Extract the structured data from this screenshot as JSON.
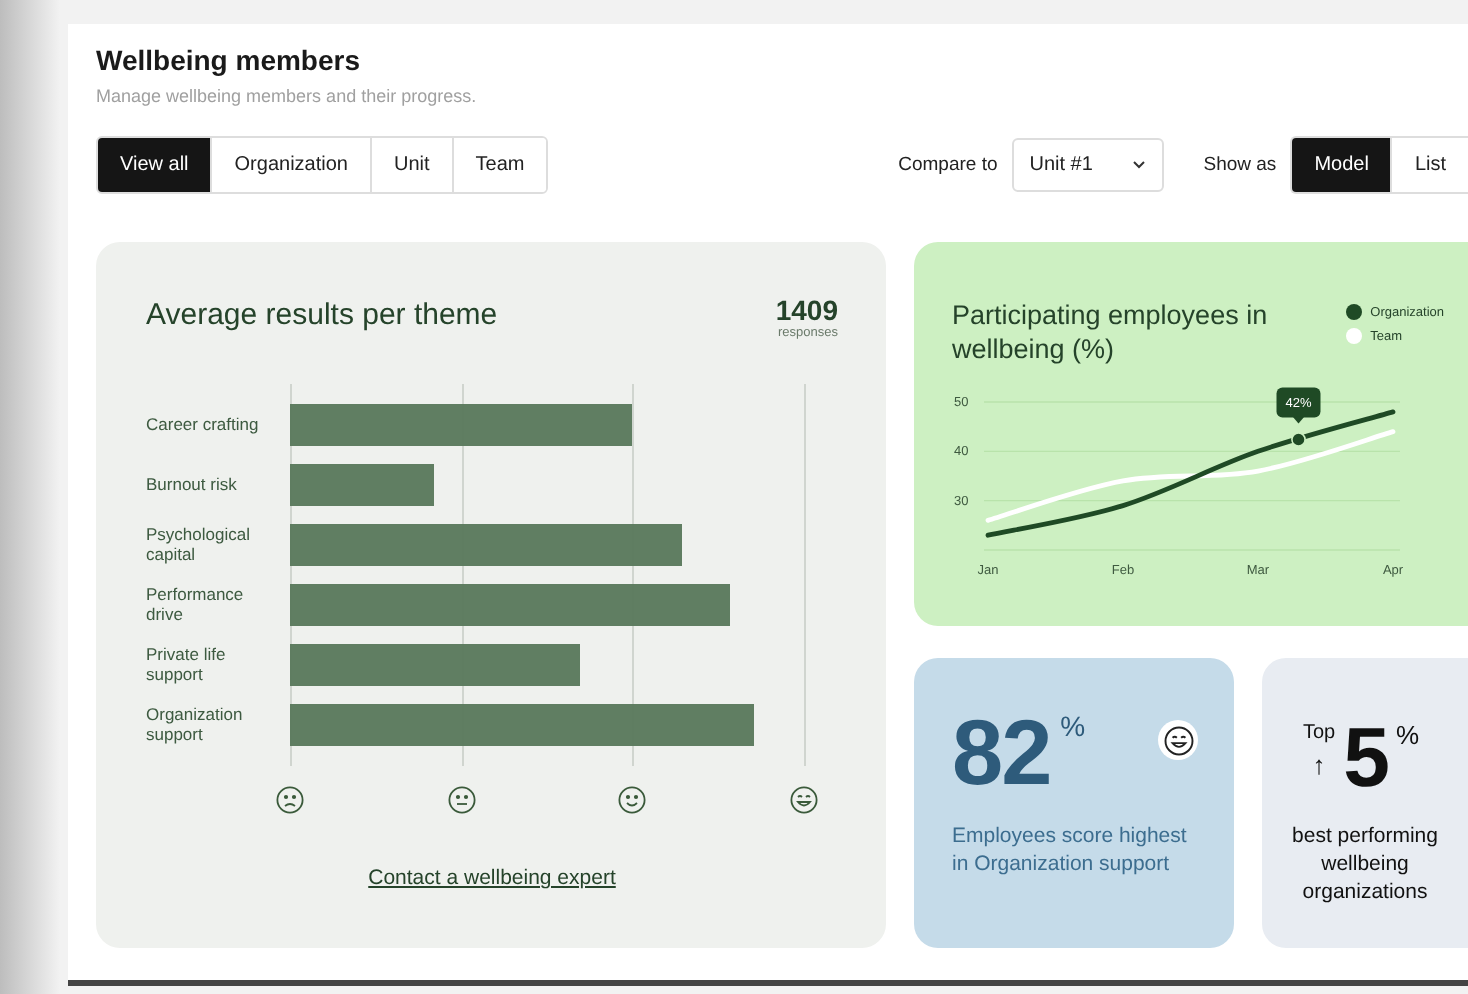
{
  "page": {
    "title": "Wellbeing members",
    "subtitle": "Manage wellbeing members and their progress."
  },
  "filters": [
    {
      "label": "View all",
      "selected": true
    },
    {
      "label": "Organization",
      "selected": false
    },
    {
      "label": "Unit",
      "selected": false
    },
    {
      "label": "Team",
      "selected": false
    }
  ],
  "compare": {
    "label": "Compare to",
    "value": "Unit #1"
  },
  "show_as": {
    "label": "Show as",
    "options": [
      {
        "label": "Model",
        "selected": true
      },
      {
        "label": "List",
        "selected": false
      }
    ]
  },
  "themes_card": {
    "title": "Average results per theme",
    "count": "1409",
    "count_label": "responses",
    "themes": [
      {
        "label": "Career crafting"
      },
      {
        "label": "Burnout risk"
      },
      {
        "label": "Psychological capital"
      },
      {
        "label": "Performance drive"
      },
      {
        "label": "Private life support"
      },
      {
        "label": "Organization support"
      }
    ],
    "link": "Contact a wellbeing expert"
  },
  "participation_card": {
    "title": "Participating employees in wellbeing (%)",
    "chart_data": {
      "type": "line",
      "x": [
        "Jan",
        "Feb",
        "Mar",
        "Apr"
      ],
      "ylim": [
        20,
        50
      ],
      "yticks": [
        30,
        40,
        50
      ],
      "series": [
        {
          "name": "Organization",
          "color": "#1f4a25",
          "values": [
            23,
            29,
            40,
            48
          ]
        },
        {
          "name": "Team",
          "color": "#ffffff",
          "values": [
            26,
            34,
            36,
            44
          ]
        }
      ],
      "annotations": [
        "42%"
      ]
    }
  },
  "highlight_card": {
    "value": "82",
    "unit": "%",
    "text": "Employees score highest in Organization support"
  },
  "rank_card": {
    "prefix": "Top",
    "arrow": "↑",
    "value": "5",
    "unit": "%",
    "text": "best performing wellbeing organizations"
  }
}
